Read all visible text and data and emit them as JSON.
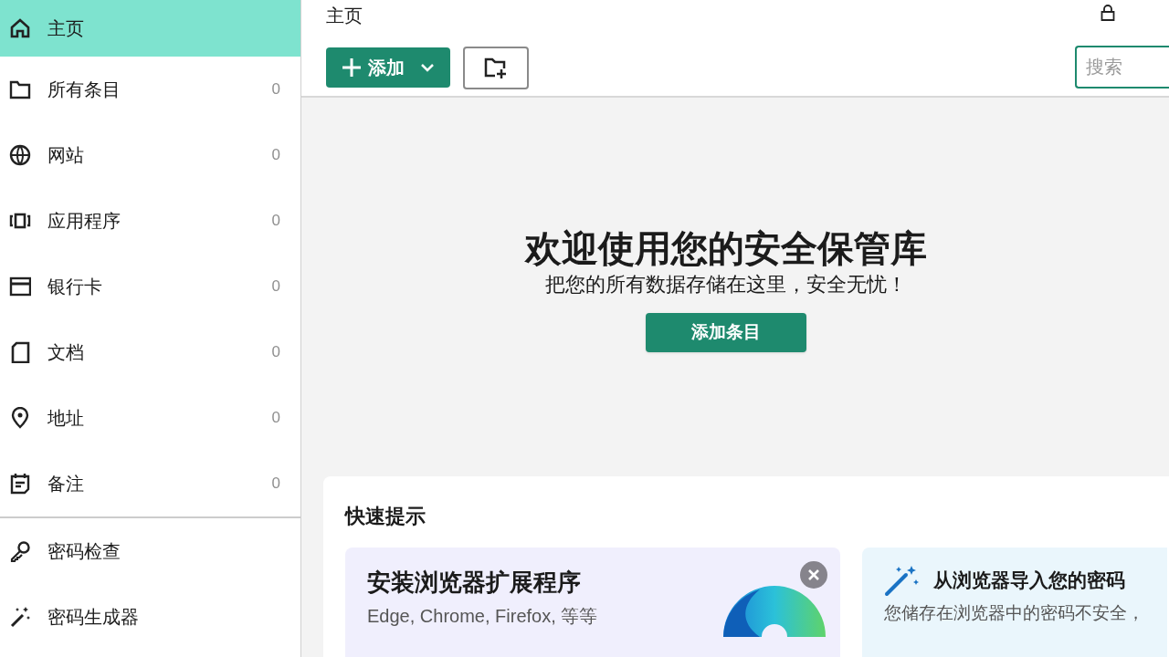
{
  "sidebar": {
    "items": [
      {
        "label": "主页",
        "kind": "home",
        "selected": true
      },
      {
        "label": "所有条目",
        "kind": "folder",
        "count": "0",
        "selected": false
      },
      {
        "label": "网站",
        "kind": "globe",
        "count": "0",
        "selected": false
      },
      {
        "label": "应用程序",
        "kind": "app",
        "count": "0",
        "selected": false
      },
      {
        "label": "银行卡",
        "kind": "card",
        "count": "0",
        "selected": false
      },
      {
        "label": "文档",
        "kind": "document",
        "count": "0",
        "selected": false
      },
      {
        "label": "地址",
        "kind": "pin",
        "count": "0",
        "selected": false
      },
      {
        "label": "备注",
        "kind": "note",
        "count": "0",
        "selected": false
      }
    ],
    "tools": [
      {
        "label": "密码检查",
        "kind": "key",
        "selected": false
      },
      {
        "label": "密码生成器",
        "kind": "wand",
        "selected": false
      }
    ]
  },
  "header": {
    "title": "主页",
    "add_button": "添加",
    "search": {
      "placeholder": "搜索"
    }
  },
  "welcome": {
    "title": "欢迎使用您的安全保管库",
    "subtitle": "把您的所有数据存储在这里，安全无忧！",
    "button": "添加条目"
  },
  "quick_tips": {
    "title": "快速提示",
    "tips": [
      {
        "kind": "extension",
        "title": "安装浏览器扩展程序",
        "text": "Edge, Chrome, Firefox, 等等"
      },
      {
        "kind": "import",
        "title": "从浏览器导入您的密码",
        "text": "您储存在浏览器中的密码不安全，"
      }
    ]
  }
}
